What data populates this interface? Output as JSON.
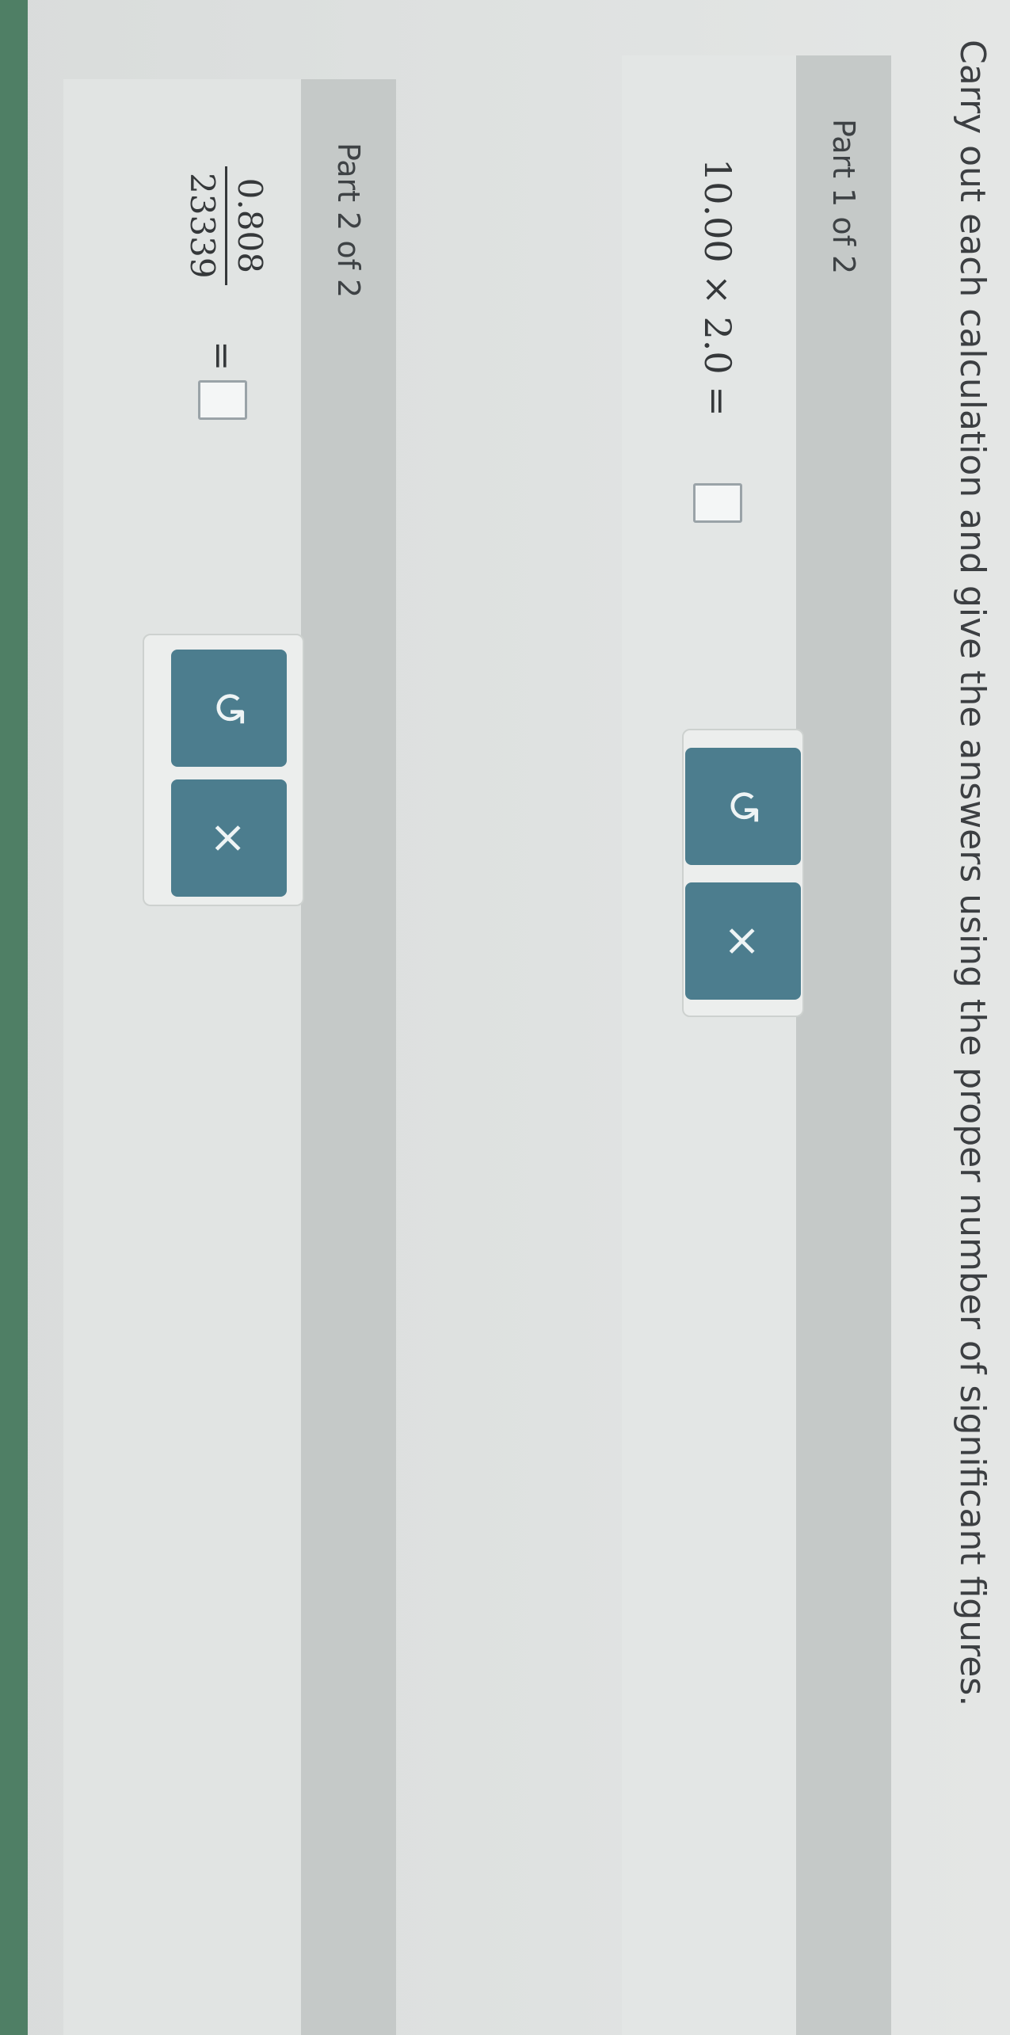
{
  "instruction": "Carry out each calculation and give the answers using the proper number of significant figures.",
  "parts": [
    {
      "header": "Part 1 of 2",
      "expression": "10.00 × 2.0 =",
      "answer_value": "",
      "buttons": {
        "undo_glyph": "↺",
        "clear_glyph": "×"
      }
    },
    {
      "header": "Part 2 of 2",
      "fraction": {
        "numerator": "0.808",
        "denominator": "23339"
      },
      "equals": "=",
      "answer_value": "",
      "buttons": {
        "undo_glyph": "↺",
        "clear_glyph": "×"
      }
    }
  ],
  "colors": {
    "button": "#4c7d8e",
    "header": "#c5c9c8",
    "accent_edge": "#4f7f65"
  }
}
